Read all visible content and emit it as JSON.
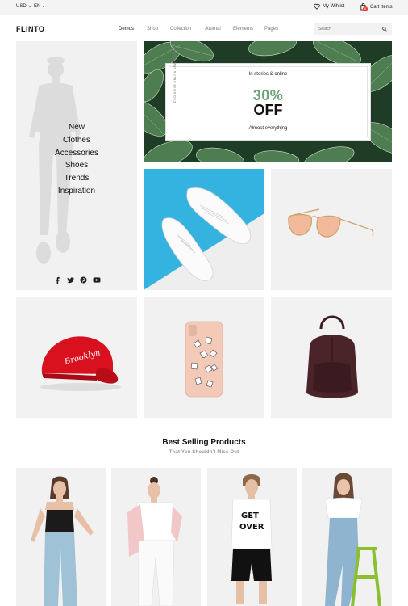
{
  "topbar": {
    "currency": "USD",
    "language": "EN",
    "wishlist_label": "My Wihlist",
    "cart_label": "Cart Items",
    "cart_count": "0"
  },
  "header": {
    "logo": "FLINTO",
    "nav": [
      "Demos",
      "Shop",
      "Collection",
      "Journal",
      "Elements",
      "Pages"
    ],
    "active_nav": "Demos",
    "search_placeholder": "Search"
  },
  "sidebar": {
    "menu": [
      "New",
      "Clothes",
      "Accessories",
      "Shoes",
      "Trends",
      "Inspiration"
    ],
    "social_icons": [
      "facebook-icon",
      "twitter-icon",
      "pinterest-icon",
      "youtube-icon"
    ]
  },
  "hero": {
    "vertical_text": "EXCLUSIVE ONLY & NEW ARRIVALS",
    "kicker": "In stories & online",
    "discount": "30%",
    "off": "OFF",
    "footnote": "Almost everything"
  },
  "best_selling": {
    "title": "Best Selling Products",
    "subtitle": "That You Shouldn't Miss Out"
  },
  "colors": {
    "accent_green": "#6fa37c",
    "badge_red": "#e53935",
    "tile_grey": "#f1f1f1",
    "sky_blue": "#3cb6e3"
  }
}
